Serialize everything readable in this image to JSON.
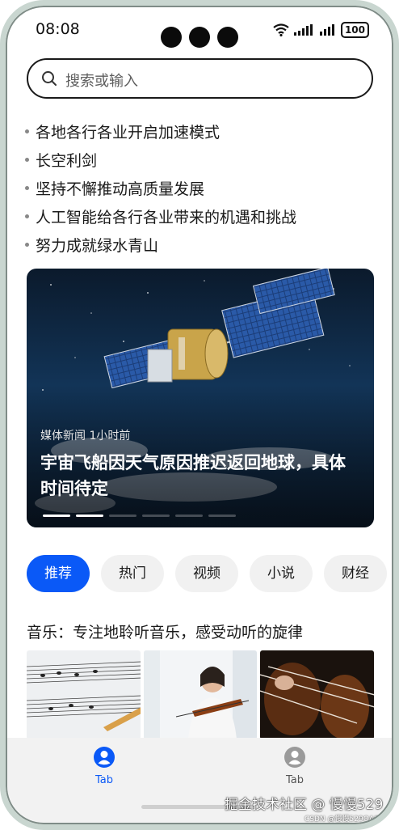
{
  "status_bar": {
    "time": "08:08",
    "battery": "100"
  },
  "search": {
    "placeholder": "搜索或输入"
  },
  "headlines": [
    "各地各行各业开启加速模式",
    "长空利剑",
    "坚持不懈推动高质量发展",
    "人工智能给各行各业带来的机遇和挑战",
    "努力成就绿水青山"
  ],
  "banner": {
    "source": "媒体新闻 1小时前",
    "title": "宇宙飞船因天气原因推迟返回地球，具体时间待定",
    "page_count": 6,
    "active_page": 1
  },
  "categories": [
    {
      "label": "推荐",
      "active": true
    },
    {
      "label": "热门",
      "active": false
    },
    {
      "label": "视频",
      "active": false
    },
    {
      "label": "小说",
      "active": false
    },
    {
      "label": "财经",
      "active": false
    }
  ],
  "music_section": {
    "title": "音乐：专注地聆听音乐，感受动听的旋律"
  },
  "tabbar": {
    "items": [
      {
        "label": "Tab",
        "active": true,
        "icon": "person-icon"
      },
      {
        "label": "Tab",
        "active": false,
        "icon": "person-icon"
      }
    ]
  },
  "watermark": {
    "main": "掘金技术社区 @ 慢慢529",
    "sub": "CSDN @慢慢529QAQ"
  },
  "colors": {
    "accent": "#0a59f7",
    "inactive": "#9a9a9a"
  }
}
